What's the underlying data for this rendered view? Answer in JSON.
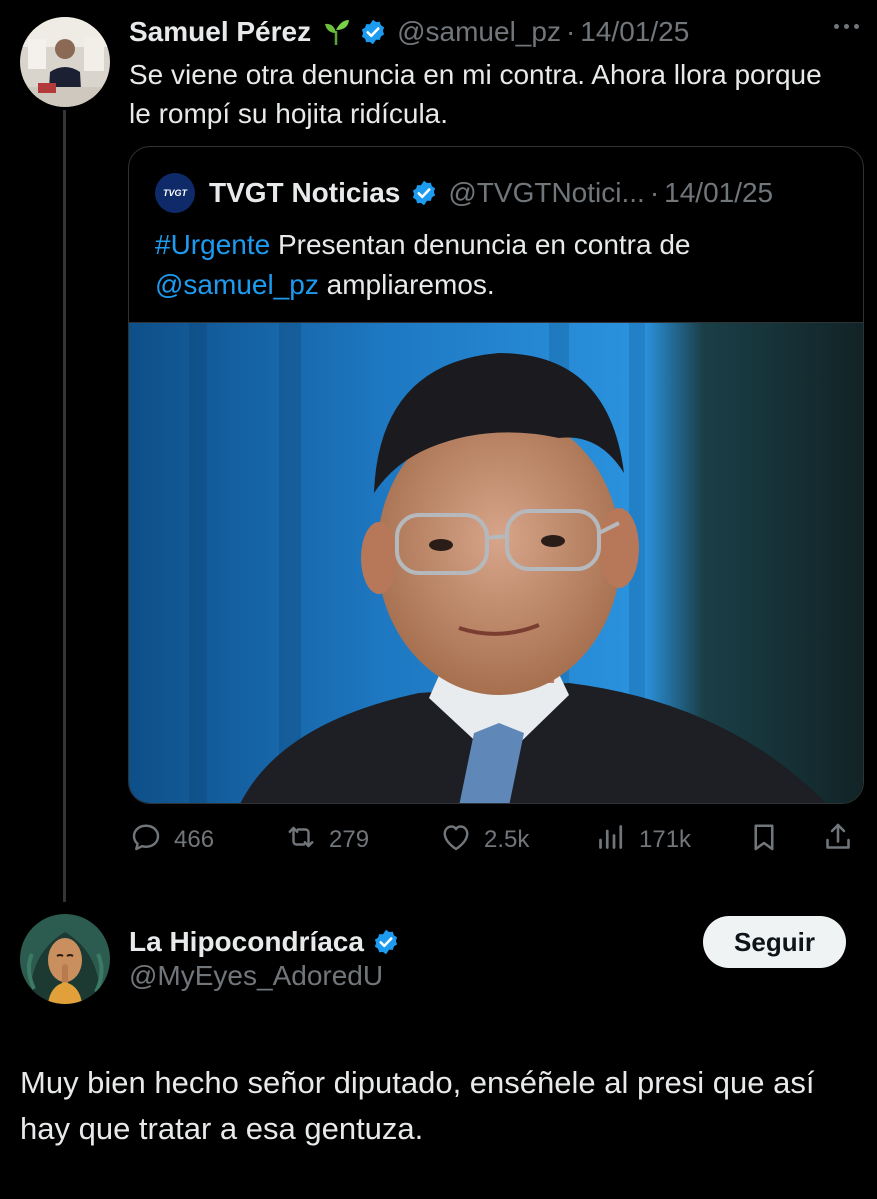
{
  "post": {
    "author_name": "Samuel Pérez",
    "author_emoji_icon": "seedling-icon",
    "handle": "@samuel_pz",
    "separator": "·",
    "date": "14/01/25",
    "text": "Se viene otra denuncia en mi contra. Ahora llora porque le rompí su hojita ridícula.",
    "quote": {
      "logo_text": "TVGT",
      "author_name": "TVGT Noticias",
      "handle": "@TVGTNotici...",
      "separator": "·",
      "date": "14/01/25",
      "hashtag": "#Urgente",
      "text_mid": " Presentan denuncia en contra de ",
      "mention": "@samuel_pz",
      "text_end": " ampliaremos."
    },
    "actions": {
      "replies": "466",
      "reposts": "279",
      "likes": "2.5k",
      "views": "171k"
    }
  },
  "reply": {
    "author_name": "La Hipocondríaca",
    "handle": "@MyEyes_AdoredU",
    "follow_label": "Seguir",
    "text": "Muy bien hecho señor diputado, enséñele al presi que así hay que tratar a esa gentuza."
  },
  "colors": {
    "background": "#000000",
    "text": "#e7e9ea",
    "muted": "#71767b",
    "link": "#1d9bf0",
    "verified": "#1d9bf0"
  }
}
